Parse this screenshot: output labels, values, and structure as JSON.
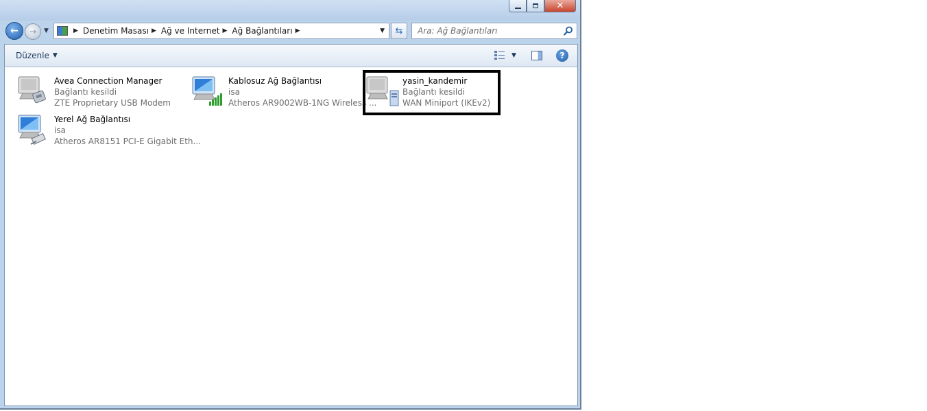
{
  "window": {
    "caption_buttons": {
      "minimize": "minimize-icon",
      "maximize": "maximize-icon",
      "close": "close-icon"
    }
  },
  "navbar": {
    "breadcrumbs": [
      {
        "label": "Denetim Masası"
      },
      {
        "label": "Ağ ve Internet"
      },
      {
        "label": "Ağ Bağlantıları"
      }
    ],
    "search_placeholder": "Ara: Ağ Bağlantıları"
  },
  "toolbar": {
    "organize_label": "Düzenle"
  },
  "connections": [
    {
      "name": "Avea Connection Manager",
      "status": "Bağlantı kesildi",
      "device": "ZTE Proprietary USB Modem",
      "icon": "modem-connection-icon"
    },
    {
      "name": "Kablosuz Ağ Bağlantısı",
      "status": "isa",
      "device": "Atheros AR9002WB-1NG Wireless ...",
      "icon": "wireless-connection-icon"
    },
    {
      "name": "yasin_kandemir",
      "status": "Bağlantı kesildi",
      "device": "WAN Miniport (IKEv2)",
      "icon": "vpn-connection-icon"
    },
    {
      "name": "Yerel Ağ Bağlantısı",
      "status": "isa",
      "device": "Atheros AR8151 PCI-E Gigabit Eth...",
      "icon": "ethernet-connection-icon"
    }
  ],
  "colors": {
    "accent": "#1e395b",
    "secondary_text": "#6d6d6d",
    "highlight_box": "#000000"
  }
}
